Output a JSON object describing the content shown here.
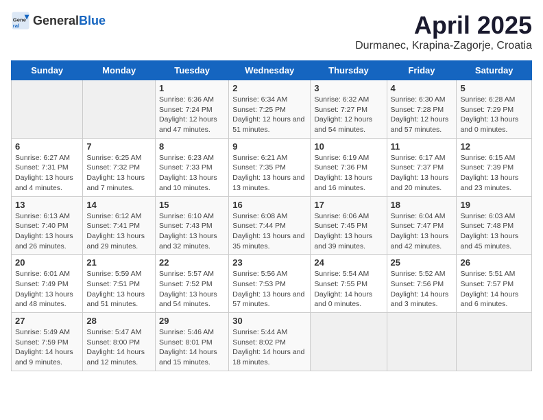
{
  "header": {
    "logo_general": "General",
    "logo_blue": "Blue",
    "month": "April 2025",
    "location": "Durmanec, Krapina-Zagorje, Croatia"
  },
  "weekdays": [
    "Sunday",
    "Monday",
    "Tuesday",
    "Wednesday",
    "Thursday",
    "Friday",
    "Saturday"
  ],
  "weeks": [
    [
      {
        "day": "",
        "info": ""
      },
      {
        "day": "",
        "info": ""
      },
      {
        "day": "1",
        "info": "Sunrise: 6:36 AM\nSunset: 7:24 PM\nDaylight: 12 hours and 47 minutes."
      },
      {
        "day": "2",
        "info": "Sunrise: 6:34 AM\nSunset: 7:25 PM\nDaylight: 12 hours and 51 minutes."
      },
      {
        "day": "3",
        "info": "Sunrise: 6:32 AM\nSunset: 7:27 PM\nDaylight: 12 hours and 54 minutes."
      },
      {
        "day": "4",
        "info": "Sunrise: 6:30 AM\nSunset: 7:28 PM\nDaylight: 12 hours and 57 minutes."
      },
      {
        "day": "5",
        "info": "Sunrise: 6:28 AM\nSunset: 7:29 PM\nDaylight: 13 hours and 0 minutes."
      }
    ],
    [
      {
        "day": "6",
        "info": "Sunrise: 6:27 AM\nSunset: 7:31 PM\nDaylight: 13 hours and 4 minutes."
      },
      {
        "day": "7",
        "info": "Sunrise: 6:25 AM\nSunset: 7:32 PM\nDaylight: 13 hours and 7 minutes."
      },
      {
        "day": "8",
        "info": "Sunrise: 6:23 AM\nSunset: 7:33 PM\nDaylight: 13 hours and 10 minutes."
      },
      {
        "day": "9",
        "info": "Sunrise: 6:21 AM\nSunset: 7:35 PM\nDaylight: 13 hours and 13 minutes."
      },
      {
        "day": "10",
        "info": "Sunrise: 6:19 AM\nSunset: 7:36 PM\nDaylight: 13 hours and 16 minutes."
      },
      {
        "day": "11",
        "info": "Sunrise: 6:17 AM\nSunset: 7:37 PM\nDaylight: 13 hours and 20 minutes."
      },
      {
        "day": "12",
        "info": "Sunrise: 6:15 AM\nSunset: 7:39 PM\nDaylight: 13 hours and 23 minutes."
      }
    ],
    [
      {
        "day": "13",
        "info": "Sunrise: 6:13 AM\nSunset: 7:40 PM\nDaylight: 13 hours and 26 minutes."
      },
      {
        "day": "14",
        "info": "Sunrise: 6:12 AM\nSunset: 7:41 PM\nDaylight: 13 hours and 29 minutes."
      },
      {
        "day": "15",
        "info": "Sunrise: 6:10 AM\nSunset: 7:43 PM\nDaylight: 13 hours and 32 minutes."
      },
      {
        "day": "16",
        "info": "Sunrise: 6:08 AM\nSunset: 7:44 PM\nDaylight: 13 hours and 35 minutes."
      },
      {
        "day": "17",
        "info": "Sunrise: 6:06 AM\nSunset: 7:45 PM\nDaylight: 13 hours and 39 minutes."
      },
      {
        "day": "18",
        "info": "Sunrise: 6:04 AM\nSunset: 7:47 PM\nDaylight: 13 hours and 42 minutes."
      },
      {
        "day": "19",
        "info": "Sunrise: 6:03 AM\nSunset: 7:48 PM\nDaylight: 13 hours and 45 minutes."
      }
    ],
    [
      {
        "day": "20",
        "info": "Sunrise: 6:01 AM\nSunset: 7:49 PM\nDaylight: 13 hours and 48 minutes."
      },
      {
        "day": "21",
        "info": "Sunrise: 5:59 AM\nSunset: 7:51 PM\nDaylight: 13 hours and 51 minutes."
      },
      {
        "day": "22",
        "info": "Sunrise: 5:57 AM\nSunset: 7:52 PM\nDaylight: 13 hours and 54 minutes."
      },
      {
        "day": "23",
        "info": "Sunrise: 5:56 AM\nSunset: 7:53 PM\nDaylight: 13 hours and 57 minutes."
      },
      {
        "day": "24",
        "info": "Sunrise: 5:54 AM\nSunset: 7:55 PM\nDaylight: 14 hours and 0 minutes."
      },
      {
        "day": "25",
        "info": "Sunrise: 5:52 AM\nSunset: 7:56 PM\nDaylight: 14 hours and 3 minutes."
      },
      {
        "day": "26",
        "info": "Sunrise: 5:51 AM\nSunset: 7:57 PM\nDaylight: 14 hours and 6 minutes."
      }
    ],
    [
      {
        "day": "27",
        "info": "Sunrise: 5:49 AM\nSunset: 7:59 PM\nDaylight: 14 hours and 9 minutes."
      },
      {
        "day": "28",
        "info": "Sunrise: 5:47 AM\nSunset: 8:00 PM\nDaylight: 14 hours and 12 minutes."
      },
      {
        "day": "29",
        "info": "Sunrise: 5:46 AM\nSunset: 8:01 PM\nDaylight: 14 hours and 15 minutes."
      },
      {
        "day": "30",
        "info": "Sunrise: 5:44 AM\nSunset: 8:02 PM\nDaylight: 14 hours and 18 minutes."
      },
      {
        "day": "",
        "info": ""
      },
      {
        "day": "",
        "info": ""
      },
      {
        "day": "",
        "info": ""
      }
    ]
  ]
}
